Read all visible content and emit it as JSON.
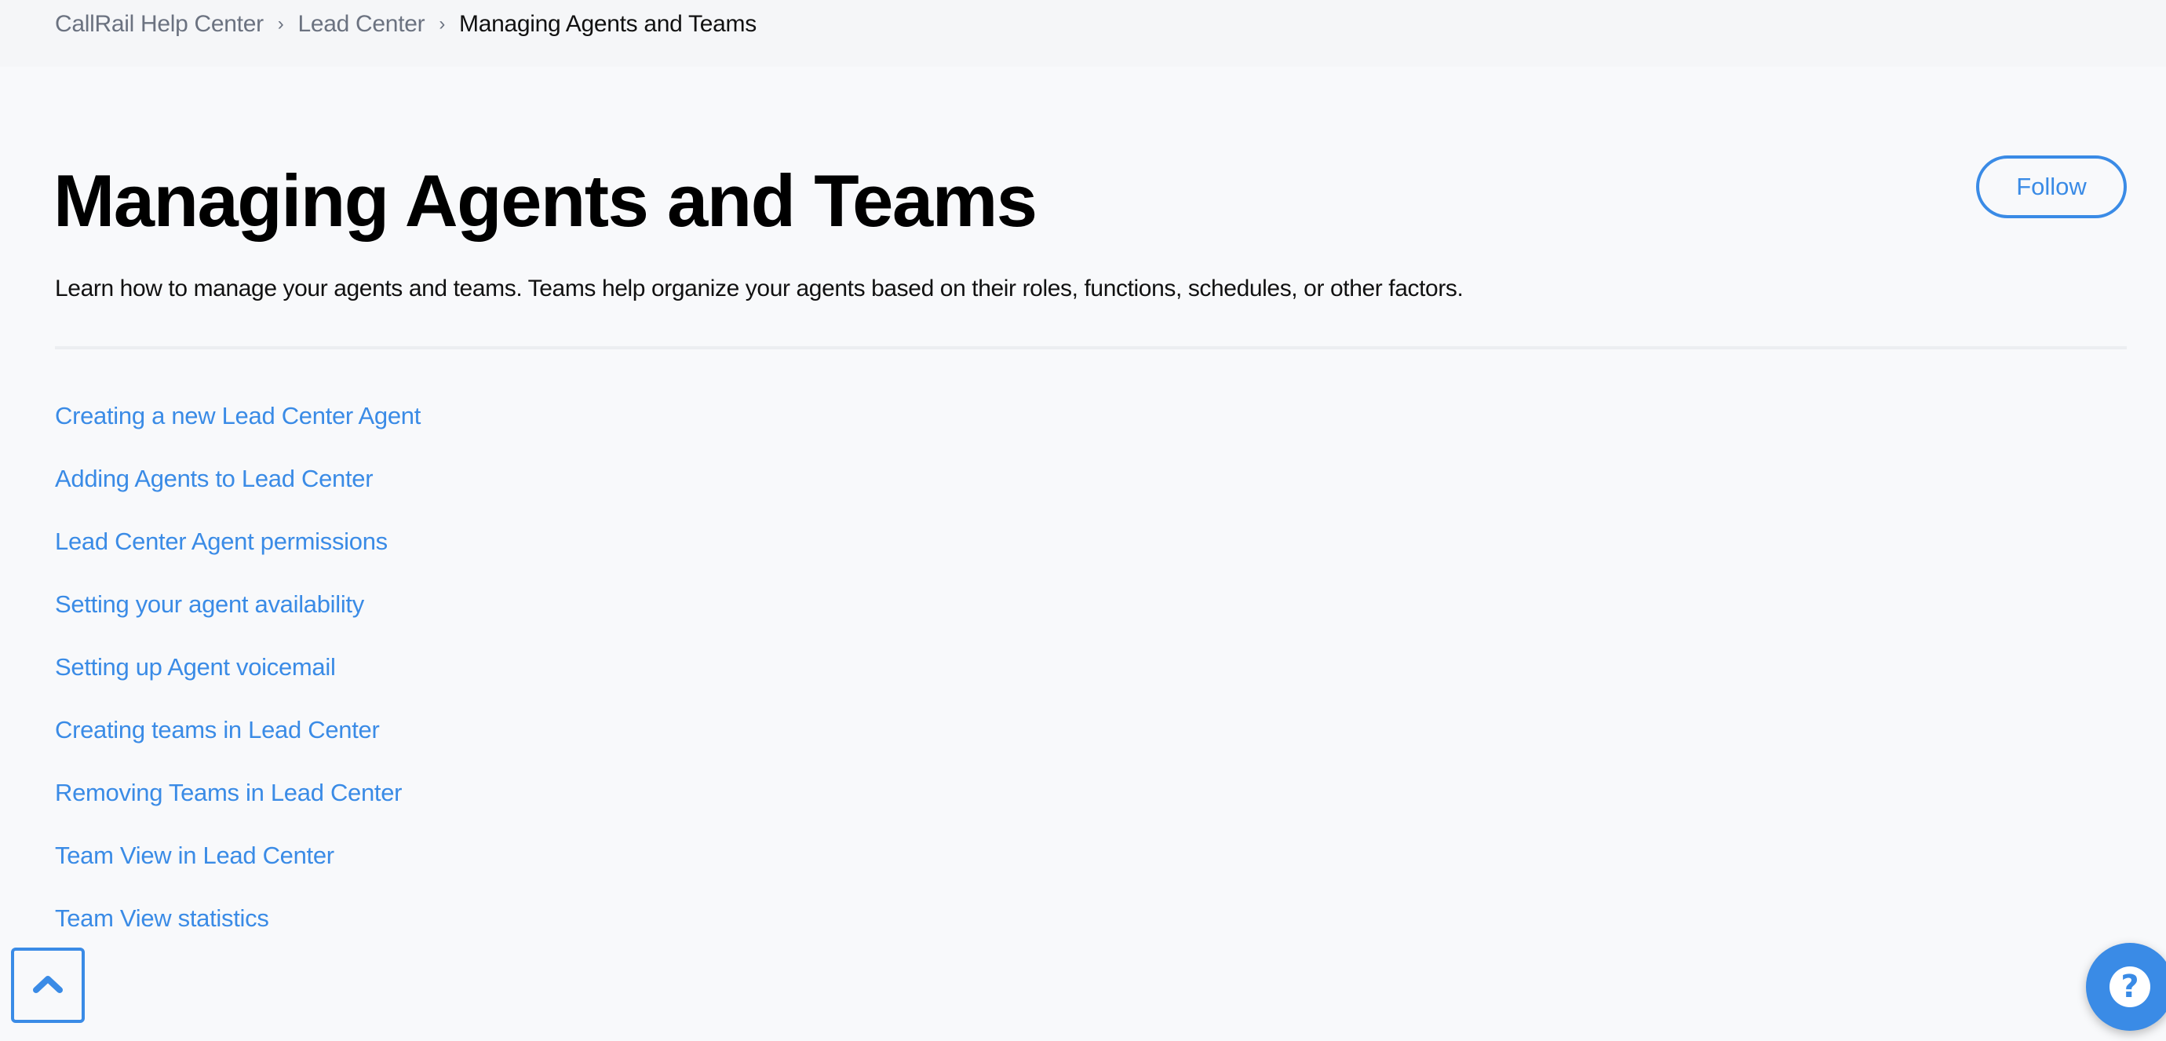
{
  "breadcrumb": {
    "items": [
      {
        "label": "CallRail Help Center"
      },
      {
        "label": "Lead Center"
      }
    ],
    "separator": "›",
    "current": "Managing Agents and Teams"
  },
  "page": {
    "title": "Managing Agents and Teams",
    "description": "Learn how to manage your agents and teams. Teams help organize your agents based on their roles, functions, schedules, or other factors.",
    "follow_label": "Follow"
  },
  "articles": [
    {
      "label": "Creating a new Lead Center Agent"
    },
    {
      "label": "Adding Agents to Lead Center"
    },
    {
      "label": "Lead Center Agent permissions"
    },
    {
      "label": "Setting your agent availability"
    },
    {
      "label": "Setting up Agent voicemail"
    },
    {
      "label": "Creating teams in Lead Center"
    },
    {
      "label": "Removing Teams in Lead Center"
    },
    {
      "label": "Team View in Lead Center"
    },
    {
      "label": "Team View statistics"
    }
  ],
  "floating": {
    "back_to_top_icon": "chevron-up-icon",
    "help_icon": "question-mark-icon",
    "help_glyph": "?"
  },
  "colors": {
    "accent": "#3a8be6",
    "background": "#f8f9fb",
    "breadcrumb_muted": "#6b7280"
  }
}
